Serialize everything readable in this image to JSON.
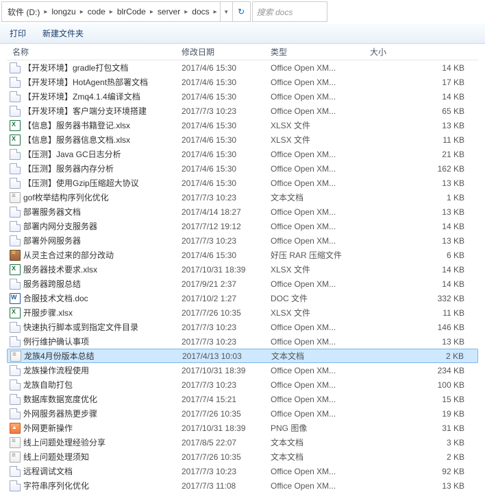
{
  "breadcrumb": [
    "软件 (D:)",
    "longzu",
    "code",
    "blrCode",
    "server",
    "docs"
  ],
  "search_placeholder": "搜索 docs",
  "toolbar": {
    "print": "打印",
    "newfolder": "新建文件夹"
  },
  "columns": {
    "name": "名称",
    "date": "修改日期",
    "type": "类型",
    "size": "大小"
  },
  "files": [
    {
      "icon": "doc",
      "name": "【开发环境】gradle打包文档",
      "date": "2017/4/6 15:30",
      "type": "Office Open XM...",
      "size": "14 KB"
    },
    {
      "icon": "doc",
      "name": "【开发环境】HotAgent热部署文档",
      "date": "2017/4/6 15:30",
      "type": "Office Open XM...",
      "size": "17 KB"
    },
    {
      "icon": "doc",
      "name": "【开发环境】Zmq4.1.4编译文档",
      "date": "2017/4/6 15:30",
      "type": "Office Open XM...",
      "size": "14 KB"
    },
    {
      "icon": "doc",
      "name": "【开发环境】客户端分支环境搭建",
      "date": "2017/7/3 10:23",
      "type": "Office Open XM...",
      "size": "65 KB"
    },
    {
      "icon": "xl",
      "name": "【信息】服务器书籍登记.xlsx",
      "date": "2017/4/6 15:30",
      "type": "XLSX 文件",
      "size": "13 KB"
    },
    {
      "icon": "xl",
      "name": "【信息】服务器信息文档.xlsx",
      "date": "2017/4/6 15:30",
      "type": "XLSX 文件",
      "size": "11 KB"
    },
    {
      "icon": "doc",
      "name": "【压测】Java GC日志分析",
      "date": "2017/4/6 15:30",
      "type": "Office Open XM...",
      "size": "21 KB"
    },
    {
      "icon": "doc",
      "name": "【压测】服务器内存分析",
      "date": "2017/4/6 15:30",
      "type": "Office Open XM...",
      "size": "162 KB"
    },
    {
      "icon": "doc",
      "name": "【压测】使用Gzip压缩超大协议",
      "date": "2017/4/6 15:30",
      "type": "Office Open XM...",
      "size": "13 KB"
    },
    {
      "icon": "txt",
      "name": "gof枚举结构序列化优化",
      "date": "2017/7/3 10:23",
      "type": "文本文档",
      "size": "1 KB"
    },
    {
      "icon": "doc",
      "name": "部署服务器文档",
      "date": "2017/4/14 18:27",
      "type": "Office Open XM...",
      "size": "13 KB"
    },
    {
      "icon": "doc",
      "name": "部署内网分支服务器",
      "date": "2017/7/12 19:12",
      "type": "Office Open XM...",
      "size": "14 KB"
    },
    {
      "icon": "doc",
      "name": "部署外网服务器",
      "date": "2017/7/3 10:23",
      "type": "Office Open XM...",
      "size": "13 KB"
    },
    {
      "icon": "rar",
      "name": "从灵主合过来的部分改动",
      "date": "2017/4/6 15:30",
      "type": "好压 RAR 压缩文件",
      "size": "6 KB"
    },
    {
      "icon": "xl",
      "name": "服务器技术要求.xlsx",
      "date": "2017/10/31 18:39",
      "type": "XLSX 文件",
      "size": "14 KB"
    },
    {
      "icon": "doc",
      "name": "服务器跨服总结",
      "date": "2017/9/21 2:37",
      "type": "Office Open XM...",
      "size": "14 KB"
    },
    {
      "icon": "word",
      "name": "合服技术文档.doc",
      "date": "2017/10/2 1:27",
      "type": "DOC 文件",
      "size": "332 KB"
    },
    {
      "icon": "xl",
      "name": "开服步骤.xlsx",
      "date": "2017/7/26 10:35",
      "type": "XLSX 文件",
      "size": "11 KB"
    },
    {
      "icon": "doc",
      "name": "快速执行脚本或到指定文件目录",
      "date": "2017/7/3 10:23",
      "type": "Office Open XM...",
      "size": "146 KB"
    },
    {
      "icon": "doc",
      "name": "例行维护确认事项",
      "date": "2017/7/3 10:23",
      "type": "Office Open XM...",
      "size": "13 KB"
    },
    {
      "icon": "txt",
      "name": "龙族4月份版本总结",
      "date": "2017/4/13 10:03",
      "type": "文本文档",
      "size": "2 KB",
      "selected": true
    },
    {
      "icon": "doc",
      "name": "龙族操作流程使用",
      "date": "2017/10/31 18:39",
      "type": "Office Open XM...",
      "size": "234 KB"
    },
    {
      "icon": "doc",
      "name": "龙族自助打包",
      "date": "2017/7/3 10:23",
      "type": "Office Open XM...",
      "size": "100 KB"
    },
    {
      "icon": "doc",
      "name": "数据库数据宽度优化",
      "date": "2017/7/4 15:21",
      "type": "Office Open XM...",
      "size": "15 KB"
    },
    {
      "icon": "doc",
      "name": "外网服务器热更步骤",
      "date": "2017/7/26 10:35",
      "type": "Office Open XM...",
      "size": "19 KB"
    },
    {
      "icon": "png",
      "name": "外网更新操作",
      "date": "2017/10/31 18:39",
      "type": "PNG 图像",
      "size": "31 KB"
    },
    {
      "icon": "txt",
      "name": "线上问题处理经验分享",
      "date": "2017/8/5 22:07",
      "type": "文本文档",
      "size": "3 KB"
    },
    {
      "icon": "txt",
      "name": "线上问题处理须知",
      "date": "2017/7/26 10:35",
      "type": "文本文档",
      "size": "2 KB"
    },
    {
      "icon": "doc",
      "name": "远程调试文档",
      "date": "2017/7/3 10:23",
      "type": "Office Open XM...",
      "size": "92 KB"
    },
    {
      "icon": "doc",
      "name": "字符串序列化优化",
      "date": "2017/7/3 11:08",
      "type": "Office Open XM...",
      "size": "13 KB"
    }
  ]
}
